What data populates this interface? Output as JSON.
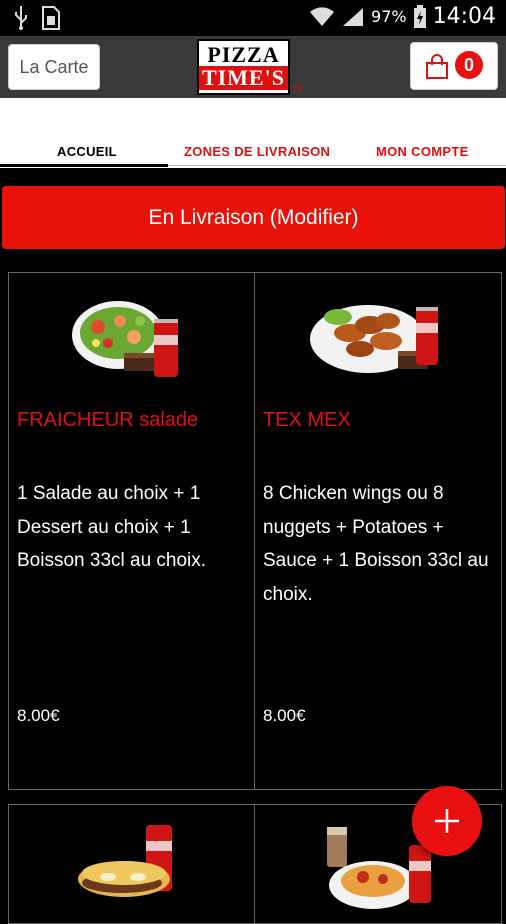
{
  "status_bar": {
    "battery_pct": "97",
    "battery_pct_unit": "%",
    "time": "14:04"
  },
  "header": {
    "menu_button_label": "La Carte",
    "logo": {
      "line1": "PIZZA",
      "line2": "TIME'S",
      "tm": "TM"
    },
    "cart_count": "0"
  },
  "tabs": [
    {
      "label": "ACCUEIL",
      "active": true
    },
    {
      "label": "ZONES DE LIVRAISON",
      "active": false
    },
    {
      "label": "MON COMPTE",
      "active": false
    }
  ],
  "delivery_button_label": "En Livraison (Modifier)",
  "menu_items": [
    {
      "title": "FRAICHEUR salade",
      "description": "1 Salade au choix  + 1 Dessert au choix  + 1 Boisson 33cl au choix.",
      "price": "8.00€",
      "image": "salad-coca-dessert"
    },
    {
      "title": "TEX MEX",
      "description": "8 Chicken wings ou 8 nuggets  + Potatoes  + Sauce  + 1 Boisson 33cl au choix.",
      "price": "8.00€",
      "image": "wings-coca-dessert"
    },
    {
      "title": "",
      "description": "",
      "price": "",
      "image": "sandwich-coca"
    },
    {
      "title": "",
      "description": "",
      "price": "",
      "image": "pasta-coca-milkshake"
    }
  ],
  "colors": {
    "accent": "#e81208",
    "appbar": "#3a3a3a",
    "background": "#000000"
  }
}
